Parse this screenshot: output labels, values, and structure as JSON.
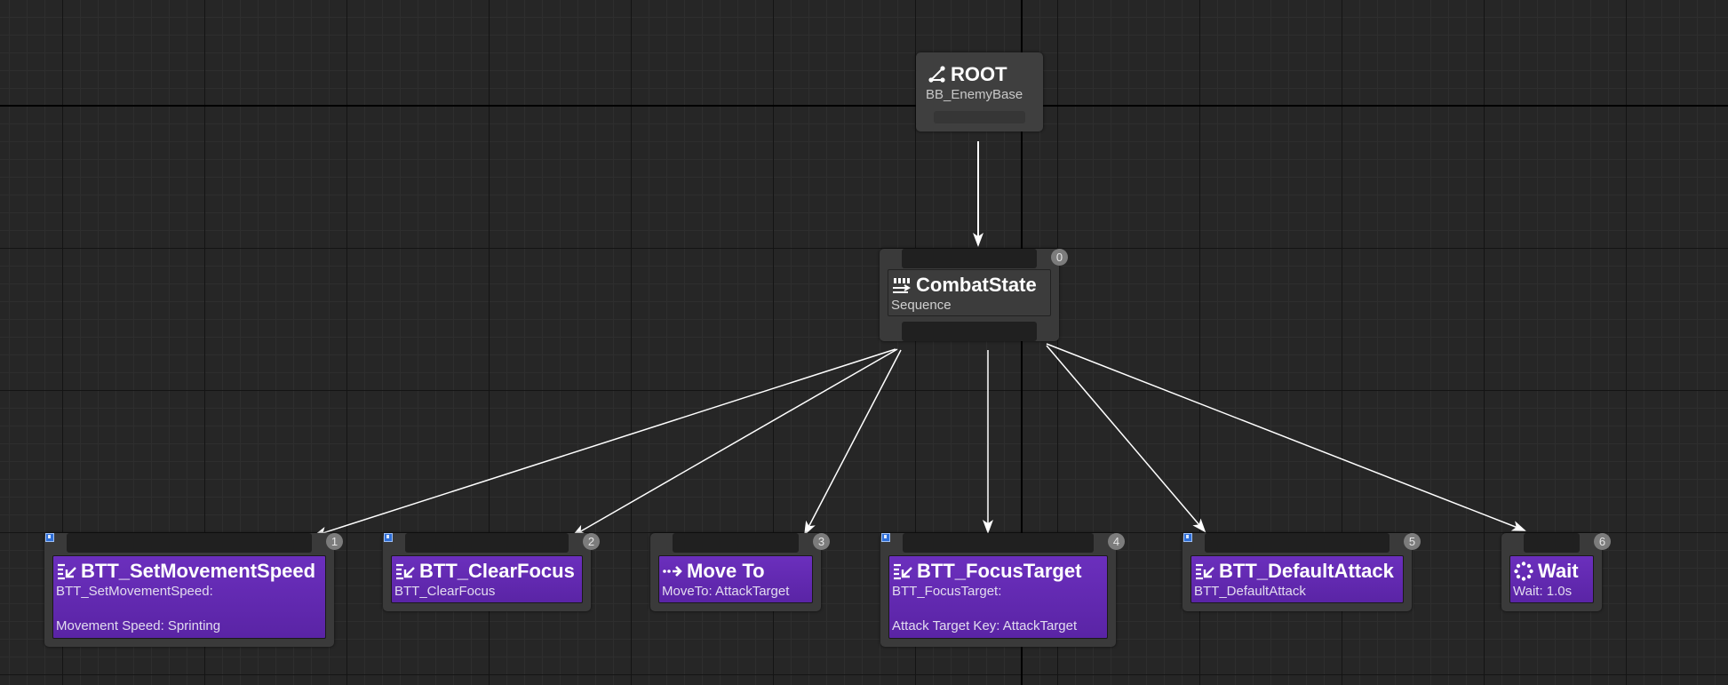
{
  "root": {
    "title": "ROOT",
    "blackboard": "BB_EnemyBase",
    "icon": "root-icon"
  },
  "composite": {
    "title": "CombatState",
    "subtitle": "Sequence",
    "order": "0",
    "icon": "sequence-icon"
  },
  "tasks": [
    {
      "title": "BTT_SetMovementSpeed",
      "line1": "BTT_SetMovementSpeed:",
      "line2": "Movement Speed: Sprinting",
      "order": "1",
      "icon": "task-icon"
    },
    {
      "title": "BTT_ClearFocus",
      "line1": "BTT_ClearFocus",
      "order": "2",
      "icon": "task-icon"
    },
    {
      "title": "Move To",
      "line1": "MoveTo: AttackTarget",
      "order": "3",
      "icon": "move-to-icon"
    },
    {
      "title": "BTT_FocusTarget",
      "line1": "BTT_FocusTarget:",
      "line2": "Attack Target Key: AttackTarget",
      "order": "4",
      "icon": "task-icon"
    },
    {
      "title": "BTT_DefaultAttack",
      "line1": "BTT_DefaultAttack",
      "order": "5",
      "icon": "task-icon"
    },
    {
      "title": "Wait",
      "line1": "Wait: 1.0s",
      "order": "6",
      "icon": "wait-icon"
    }
  ],
  "colors": {
    "task_purple": "#6b2fbd",
    "node_gray": "#3a3a3a",
    "wire": "#ffffff",
    "grid_bg": "#262626",
    "breakpoint_blue": "#2f6fd8"
  }
}
